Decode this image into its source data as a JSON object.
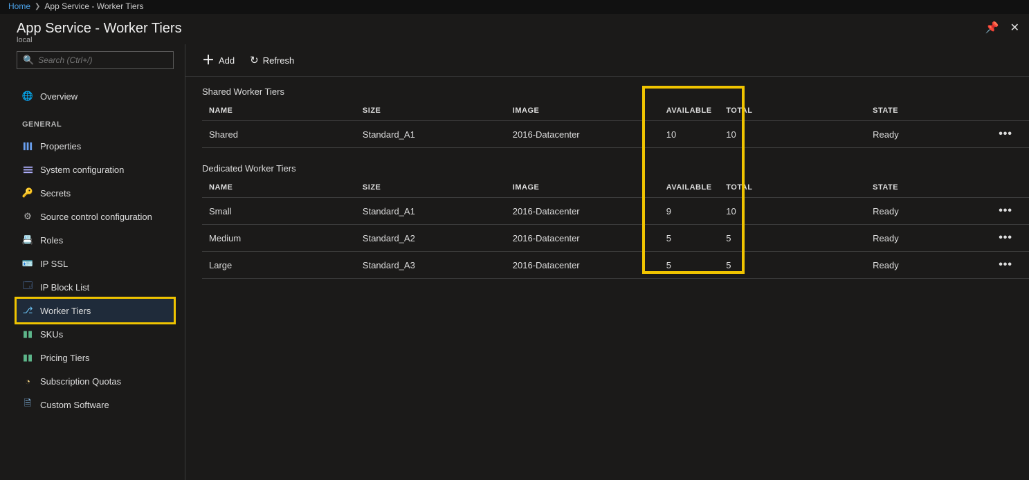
{
  "breadcrumb": {
    "home": "Home",
    "current": "App Service - Worker Tiers"
  },
  "header": {
    "title": "App Service - Worker Tiers",
    "subtitle": "local"
  },
  "search": {
    "placeholder": "Search (Ctrl+/)"
  },
  "sidebar": {
    "overview": "Overview",
    "section_general": "GENERAL",
    "items": {
      "properties": "Properties",
      "system_configuration": "System configuration",
      "secrets": "Secrets",
      "source_control_configuration": "Source control configuration",
      "roles": "Roles",
      "ip_ssl": "IP SSL",
      "ip_block_list": "IP Block List",
      "worker_tiers": "Worker Tiers",
      "skus": "SKUs",
      "pricing_tiers": "Pricing Tiers",
      "subscription_quotas": "Subscription Quotas",
      "custom_software": "Custom Software"
    }
  },
  "toolbar": {
    "add": "Add",
    "refresh": "Refresh"
  },
  "columns": {
    "name": "NAME",
    "size": "SIZE",
    "image": "IMAGE",
    "available": "AVAILABLE",
    "total": "TOTAL",
    "state": "STATE"
  },
  "sections": {
    "shared": {
      "title": "Shared Worker Tiers",
      "rows": [
        {
          "name": "Shared",
          "size": "Standard_A1",
          "image": "2016-Datacenter",
          "available": "10",
          "total": "10",
          "state": "Ready"
        }
      ]
    },
    "dedicated": {
      "title": "Dedicated Worker Tiers",
      "rows": [
        {
          "name": "Small",
          "size": "Standard_A1",
          "image": "2016-Datacenter",
          "available": "9",
          "total": "10",
          "state": "Ready"
        },
        {
          "name": "Medium",
          "size": "Standard_A2",
          "image": "2016-Datacenter",
          "available": "5",
          "total": "5",
          "state": "Ready"
        },
        {
          "name": "Large",
          "size": "Standard_A3",
          "image": "2016-Datacenter",
          "available": "5",
          "total": "5",
          "state": "Ready"
        }
      ]
    }
  }
}
